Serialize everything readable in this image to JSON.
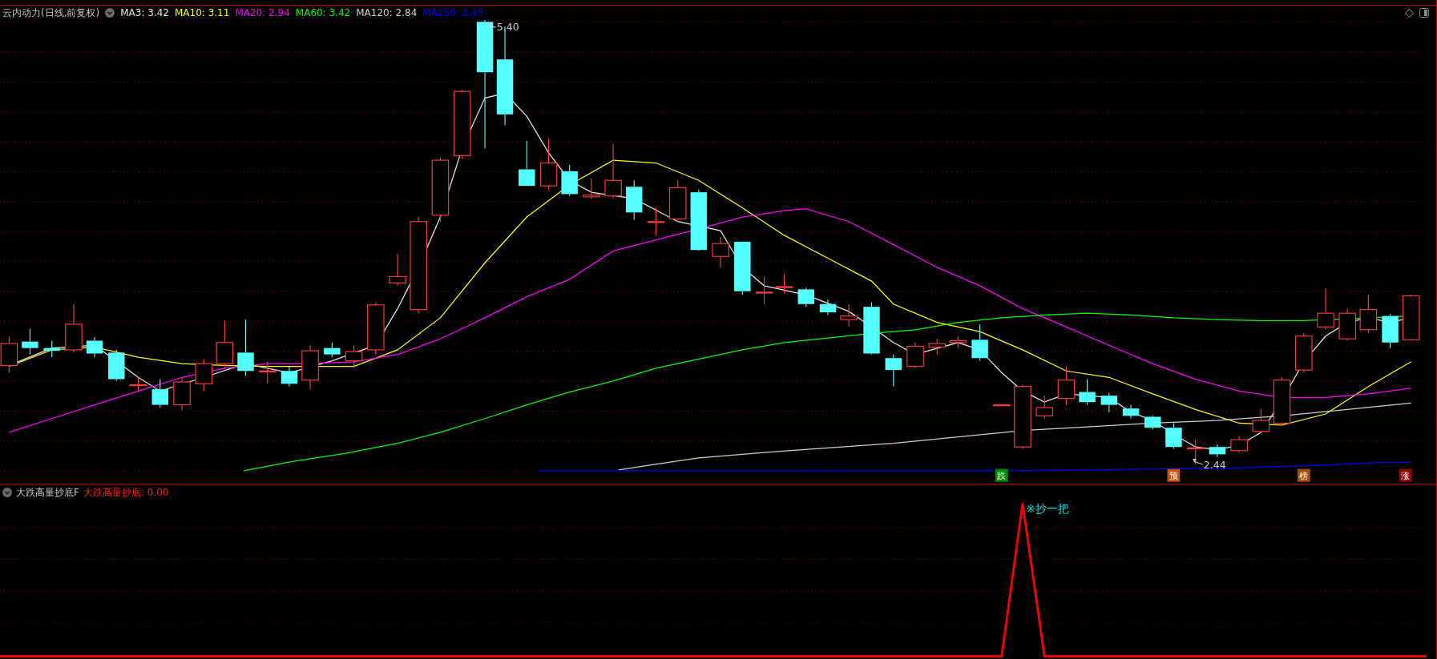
{
  "title": {
    "text": "云内动力(日线,前复权)"
  },
  "indicators": [
    {
      "label": "MA3: 3.42",
      "color": "#e6e6e6"
    },
    {
      "label": "MA10: 3.11",
      "color": "#ffff00"
    },
    {
      "label": "MA20: 2.94",
      "color": "#ff00ff"
    },
    {
      "label": "MA60: 3.42",
      "color": "#00ff00"
    },
    {
      "label": "MA120: 2.84",
      "color": "#d0d0d0"
    },
    {
      "label": "MA250: 2.45",
      "color": "#0000ff"
    }
  ],
  "main_chart": {
    "high_label": "5.40",
    "low_label": "2.44",
    "signals": [
      {
        "text": "跌",
        "color": "#008a00"
      },
      {
        "text": "预",
        "color": "#c8500a"
      },
      {
        "text": "榜",
        "color": "#a0500a"
      },
      {
        "text": "涨",
        "color": "#8a0a0a"
      }
    ]
  },
  "sub_panel": {
    "name": "大跌高量抄底F",
    "reading": "大跌高量抄底: 0.00",
    "peak_label": "※抄一把"
  }
}
